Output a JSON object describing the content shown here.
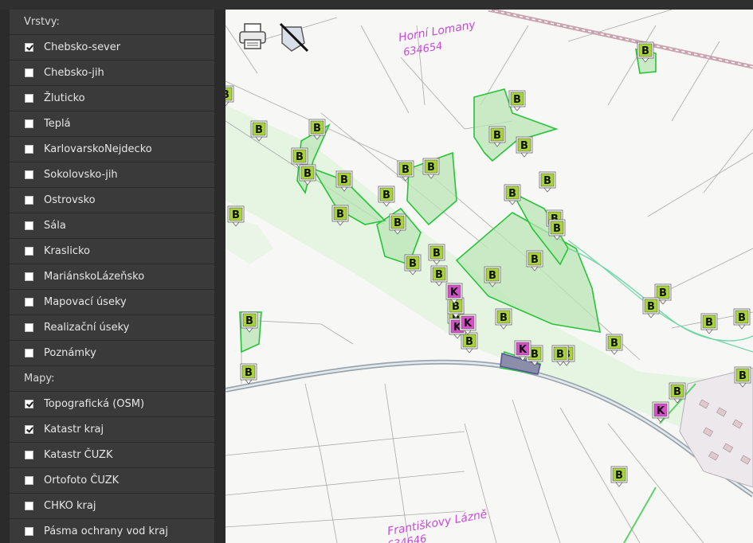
{
  "sidebar": {
    "sections": [
      {
        "heading": "Vrstvy:",
        "items": [
          {
            "label": "Chebsko-sever",
            "checked": true
          },
          {
            "label": "Chebsko-jih",
            "checked": false
          },
          {
            "label": "Žluticko",
            "checked": false
          },
          {
            "label": "Teplá",
            "checked": false
          },
          {
            "label": "KarlovarskoNejdecko",
            "checked": false
          },
          {
            "label": "Sokolovsko-jih",
            "checked": false
          },
          {
            "label": "Ostrovsko",
            "checked": false
          },
          {
            "label": "Sála",
            "checked": false
          },
          {
            "label": "Kraslicko",
            "checked": false
          },
          {
            "label": "MariánskoLázeňsko",
            "checked": false
          },
          {
            "label": "Mapovací úseky",
            "checked": false
          },
          {
            "label": "Realizační úseky",
            "checked": false
          },
          {
            "label": "Poznámky",
            "checked": false
          }
        ]
      },
      {
        "heading": "Mapy:",
        "items": [
          {
            "label": "Topografická (OSM)",
            "checked": true
          },
          {
            "label": "Katastr kraj",
            "checked": true
          },
          {
            "label": "Katastr ČUZK",
            "checked": false
          },
          {
            "label": "Ortofoto ČUZK",
            "checked": false
          },
          {
            "label": "CHKO kraj",
            "checked": false
          },
          {
            "label": "Pásma ochrany vod kraj",
            "checked": false
          }
        ]
      }
    ]
  },
  "map": {
    "toolbar": {
      "print_icon": "printer-icon",
      "clear_icon": "clear-features-icon"
    },
    "labels": {
      "top_name": "Horní Lomany",
      "top_code": "634654",
      "bottom_name": "Františkovy Lázně",
      "bottom_code": "634646"
    },
    "marker_letters": {
      "b": "B",
      "k": "K"
    },
    "colors": {
      "marker_b": "#a8d438",
      "marker_k": "#d64fc8",
      "polygon_fill": "#b9e6b4",
      "polygon_stroke": "#27c43a",
      "cadastre_text": "#c64bd8",
      "road": "#9aa6ad"
    }
  }
}
